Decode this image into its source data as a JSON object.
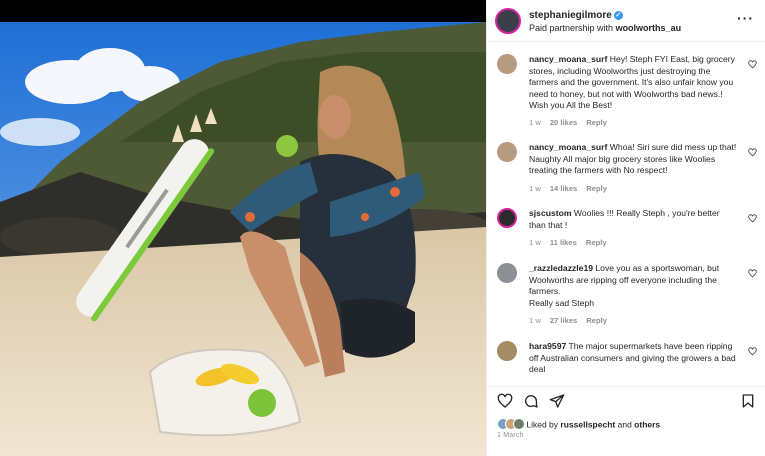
{
  "post": {
    "username": "stephaniegilmore",
    "verified_mark": "✓",
    "partnership_prefix": "Paid partnership with",
    "partner": "woolworths_au",
    "more_icon": "ellipsis-icon",
    "more_label": "···"
  },
  "comments": [
    {
      "user": "nancy_moana_surf",
      "text": "Hey! Steph FYI East, big grocery stores, including Woolworths just destroying the farmers and the government. It's also unfair know you need to honey, but not with Woolworths bad news.! Wish you All the Best!",
      "age": "1 w",
      "likes": "20 likes",
      "reply": "Reply"
    },
    {
      "user": "nancy_moana_surf",
      "text": "Whoa! Siri sure did mess up that! Naughty All major big grocery stores like Woolies treating the farmers with No respect!",
      "age": "1 w",
      "likes": "14 likes",
      "reply": "Reply"
    },
    {
      "user": "sjscustom",
      "text": "Woolies !!! Really Steph , you're better than that !",
      "age": "1 w",
      "likes": "11 likes",
      "reply": "Reply"
    },
    {
      "user": "_razzledazzle19",
      "text": "Love you as a sportswoman, but Woolworths are ripping off everyone including the farmers.",
      "text2": "Really sad Steph",
      "age": "1 w",
      "likes": "27 likes",
      "reply": "Reply"
    },
    {
      "user": "hara9597",
      "text": "The major supermarkets have been ripping off Australian consumers and giving the growers a bad deal",
      "age": "",
      "likes": "",
      "reply": ""
    }
  ],
  "footer": {
    "liked_prefix": "Liked by",
    "liked_user": "russellspecht",
    "liked_and": "and",
    "liked_others": "others",
    "date": "1 March"
  },
  "icons": {
    "like": "heart-icon",
    "comment": "comment-icon",
    "share": "paper-plane-icon",
    "save": "bookmark-icon"
  },
  "colors": {
    "verified": "#3897f0",
    "story_ring": "#d6249f",
    "text": "#262626",
    "meta": "#8e8e8e"
  }
}
